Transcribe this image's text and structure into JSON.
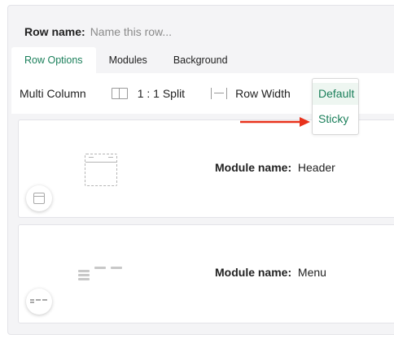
{
  "row": {
    "name_label": "Row name:",
    "name_value": "",
    "name_placeholder": "Name this row..."
  },
  "tabs": [
    {
      "label": "Row Options",
      "active": true
    },
    {
      "label": "Modules",
      "active": false
    },
    {
      "label": "Background",
      "active": false
    }
  ],
  "toolbar": {
    "layout_label": "Multi Column",
    "split_icon": "split-columns-icon",
    "split_label": "1 : 1 Split",
    "width_icon": "row-width-icon",
    "width_label": "Row Width"
  },
  "width_dropdown": {
    "options": [
      "Default",
      "Sticky"
    ],
    "selected": "Default"
  },
  "annotation": {
    "arrow_color": "#e8321c",
    "points_to": "Sticky"
  },
  "modules": [
    {
      "name_label": "Module name:",
      "name": "Header",
      "preview_icon": "header-layout-icon",
      "badge_icon": "header-module-icon"
    },
    {
      "name_label": "Module name:",
      "name": "Menu",
      "preview_icon": "menu-layout-icon",
      "badge_icon": "menu-module-icon"
    }
  ],
  "colors": {
    "accent": "#1a7f5a",
    "panel_bg": "#f4f4f6"
  }
}
